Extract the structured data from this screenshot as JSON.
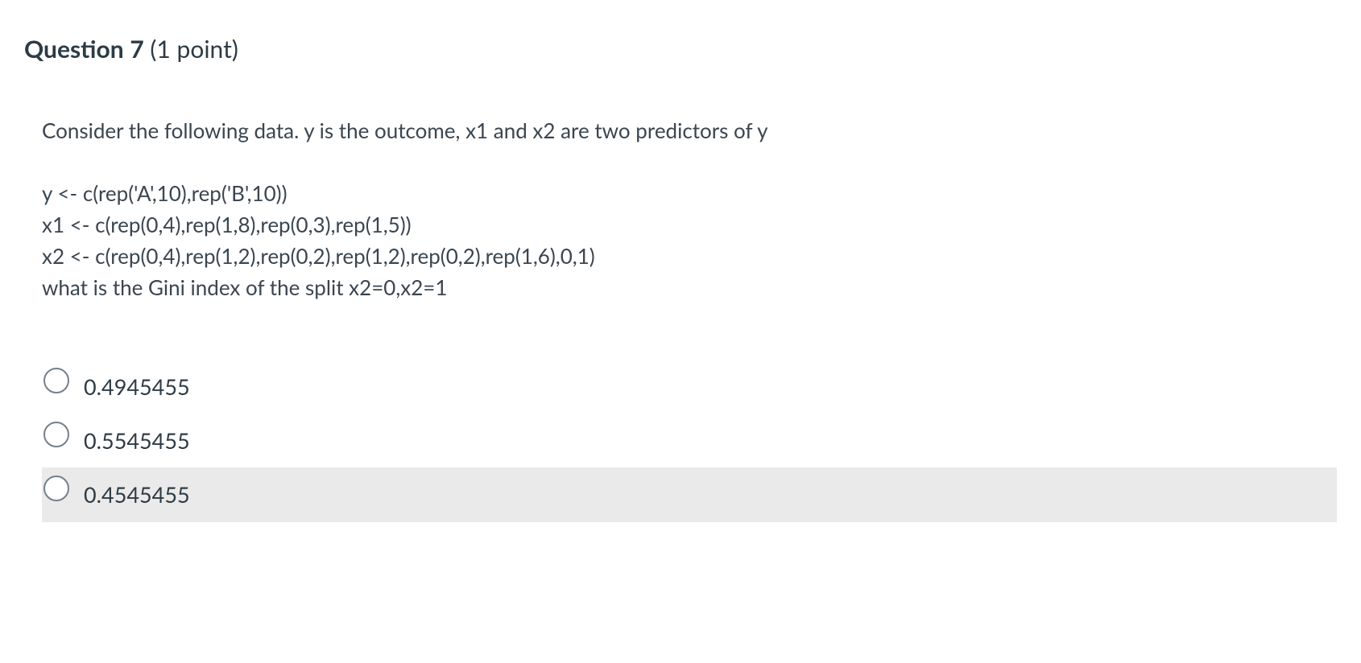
{
  "header": {
    "label": "Question",
    "number": "7",
    "points": "(1 point)"
  },
  "prompt": "Consider the following data. y is the outcome, x1 and x2 are two predictors of y",
  "code": {
    "line1": "y <- c(rep('A',10),rep('B',10))",
    "line2": "x1 <- c(rep(0,4),rep(1,8),rep(0,3),rep(1,5))",
    "line3": "x2 <- c(rep(0,4),rep(1,2),rep(0,2),rep(1,2),rep(0,2),rep(1,6),0,1)",
    "line4": "what is the Gini index  of the split x2=0,x2=1"
  },
  "options": {
    "a": "0.4945455",
    "b": "0.5545455",
    "c": "0.4545455"
  }
}
